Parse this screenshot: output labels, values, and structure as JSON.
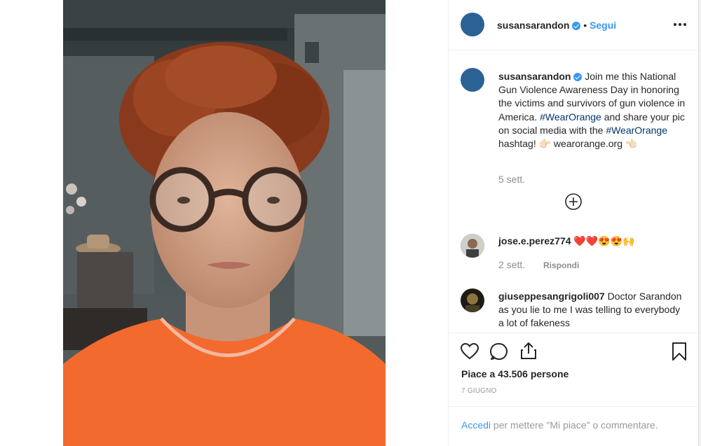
{
  "post": {
    "username": "susansarandon",
    "follow_label": "Segui",
    "dot": "•",
    "caption": {
      "text_1": "Join me this National Gun Violence Awareness Day in honoring the victims and survivors of gun violence in America.",
      "tag_1": "#WearOrange",
      "text_2": "and share your pic on social media with the",
      "tag_2": "#WearOrange",
      "text_3": "hashtag! 👉🏻 wearorange.org 👈🏻",
      "age": "5 sett."
    },
    "load_more_label": "⊕",
    "comments": [
      {
        "username": "jose.e.perez774",
        "text": "❤️❤️😍😍🙌",
        "age": "2 sett.",
        "reply_label": "Rispondi"
      },
      {
        "username": "giuseppesangrigoli007",
        "text": "Doctor Sarandon as you lie to me I was telling to everybody a lot of fakeness"
      }
    ],
    "likes_text": "Piace a 43.506 persone",
    "date": "7 GIUGNO",
    "login_link": "Accedi",
    "login_rest": "per mettere \"Mi piace\" o commentare."
  },
  "icons": {
    "more": "more-options-icon",
    "heart": "heart-icon",
    "comment": "comment-icon",
    "share": "share-icon",
    "save": "bookmark-icon",
    "load_more": "plus-circle-icon"
  },
  "colors": {
    "link": "#3897f0",
    "hashtag": "#003569",
    "verified": "#3897f0",
    "shirt": "#f26a2e"
  }
}
